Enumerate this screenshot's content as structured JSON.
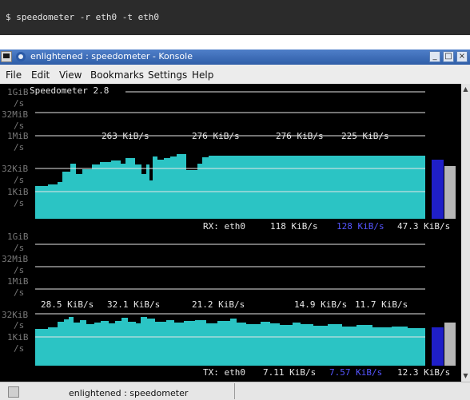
{
  "command": "$ speedometer -r eth0 -t eth0",
  "window": {
    "title": "enlightened : speedometer - Konsole",
    "buttons": [
      "_",
      "□",
      "×"
    ]
  },
  "menu": [
    "File",
    "Edit",
    "View",
    "Bookmarks",
    "Settings",
    "Help"
  ],
  "colors": {
    "fill": "#2bc4c4",
    "bar_blue": "#1f1fc8",
    "bar_grey": "#b7b7b7",
    "label_grey": "#777777",
    "text": "#e6e6e6",
    "avg_blue": "#5555ff"
  },
  "terminal": {
    "app_name": "Speedometer 2.8",
    "scale_labels": [
      "1GiB",
      "/s",
      "32MiB",
      "/s",
      "1MiB",
      "/s",
      "32KiB",
      "/s",
      "1KiB",
      "/s"
    ],
    "rx": {
      "readings": [
        "263 KiB/s",
        "276 KiB/s",
        "276 KiB/s",
        "225 KiB/s"
      ],
      "status_label": "RX: eth0",
      "current": "118 KiB/s",
      "average": "128 KiB/s",
      "extra": "47.3 KiB/s"
    },
    "tx": {
      "readings": [
        "28.5 KiB/s",
        "32.1 KiB/s",
        "21.2 KiB/s",
        "14.9 KiB/s",
        "11.7 KiB/s"
      ],
      "status_label": "TX: eth0",
      "current": "7.11 KiB/s",
      "average": "7.57 KiB/s",
      "extra": "12.3 KiB/s"
    }
  },
  "statusbar": {
    "session": "enlightened : speedometer"
  }
}
